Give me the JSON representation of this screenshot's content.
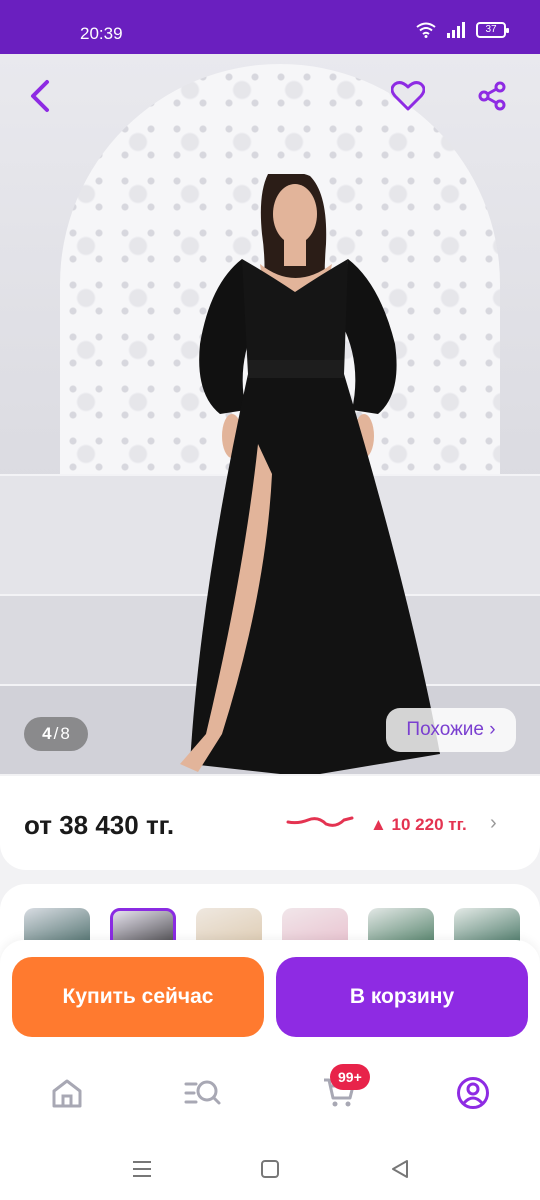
{
  "status_bar": {
    "time": "20:39",
    "battery": "37"
  },
  "gallery": {
    "current_page": "4",
    "separator": "/",
    "total_pages": "8",
    "similar_label": "Похожие ›"
  },
  "price": {
    "from_price": "от 38 430 тг.",
    "change": "▲ 10 220 тг.",
    "chevron": "›"
  },
  "variants": {
    "count": 6,
    "selected_index": 1
  },
  "actions": {
    "buy_now": "Купить сейчас",
    "add_to_cart": "В корзину"
  },
  "tabbar": {
    "cart_badge": "99+"
  },
  "colors": {
    "brand_purple": "#8e2be3",
    "status_bar": "#6a1fbf",
    "buy_orange": "#ff7a2f",
    "price_up_red": "#e43351",
    "badge_red": "#e8234a"
  }
}
